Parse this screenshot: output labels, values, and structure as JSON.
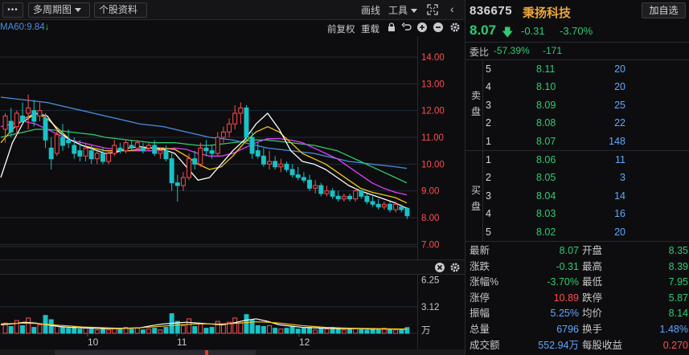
{
  "toolbar": {
    "more": "•••",
    "period": "多周期图",
    "stock_info": "个股资料",
    "draw": "画线",
    "tools": "工具",
    "fullscreen_icon": "expand-icon",
    "collapse_icon": "chevron-left-icon"
  },
  "ma_bar": {
    "ma60_text": "MA60:9.84",
    "ma60_color": "#4a90e2",
    "restore": "前复权",
    "reset": "重载"
  },
  "chart_data": [
    {
      "type": "candlestick",
      "price_axis_ticks": [
        "14.00",
        "13.00",
        "12.00",
        "11.00",
        "10.00",
        "9.00",
        "8.00",
        "7.00"
      ],
      "ylim": [
        6.8,
        14.6
      ],
      "candles": [
        {
          "o": 11.3,
          "h": 11.9,
          "l": 10.8,
          "c": 11.8
        },
        {
          "o": 11.6,
          "h": 12.1,
          "l": 11.0,
          "c": 11.2
        },
        {
          "o": 11.4,
          "h": 12.0,
          "l": 11.1,
          "c": 11.9
        },
        {
          "o": 11.8,
          "h": 12.3,
          "l": 11.5,
          "c": 11.6
        },
        {
          "o": 11.9,
          "h": 12.6,
          "l": 11.3,
          "c": 12.1
        },
        {
          "o": 12.0,
          "h": 12.4,
          "l": 11.4,
          "c": 11.6
        },
        {
          "o": 11.8,
          "h": 12.3,
          "l": 11.6,
          "c": 12.0
        },
        {
          "o": 11.7,
          "h": 11.9,
          "l": 10.6,
          "c": 10.9
        },
        {
          "o": 10.6,
          "h": 11.0,
          "l": 9.8,
          "c": 10.2
        },
        {
          "o": 10.4,
          "h": 11.3,
          "l": 10.3,
          "c": 11.1
        },
        {
          "o": 11.0,
          "h": 11.5,
          "l": 10.5,
          "c": 10.7
        },
        {
          "o": 10.9,
          "h": 11.3,
          "l": 10.6,
          "c": 10.8
        },
        {
          "o": 10.7,
          "h": 11.0,
          "l": 10.2,
          "c": 10.4
        },
        {
          "o": 10.5,
          "h": 10.9,
          "l": 10.1,
          "c": 10.3
        },
        {
          "o": 10.3,
          "h": 10.8,
          "l": 10.1,
          "c": 10.6
        },
        {
          "o": 10.5,
          "h": 10.7,
          "l": 10.0,
          "c": 10.2
        },
        {
          "o": 10.2,
          "h": 10.5,
          "l": 10.0,
          "c": 10.4
        },
        {
          "o": 10.4,
          "h": 10.6,
          "l": 10.0,
          "c": 10.1
        },
        {
          "o": 10.1,
          "h": 10.5,
          "l": 10.0,
          "c": 10.4
        },
        {
          "o": 10.4,
          "h": 10.9,
          "l": 10.3,
          "c": 10.7
        },
        {
          "o": 10.6,
          "h": 10.8,
          "l": 10.4,
          "c": 10.5
        },
        {
          "o": 10.5,
          "h": 10.9,
          "l": 10.4,
          "c": 10.8
        },
        {
          "o": 10.7,
          "h": 10.9,
          "l": 10.5,
          "c": 10.6
        },
        {
          "o": 10.6,
          "h": 10.9,
          "l": 10.5,
          "c": 10.8
        },
        {
          "o": 10.6,
          "h": 10.8,
          "l": 10.4,
          "c": 10.5
        },
        {
          "o": 10.6,
          "h": 10.8,
          "l": 10.5,
          "c": 10.7
        },
        {
          "o": 10.7,
          "h": 10.9,
          "l": 10.3,
          "c": 10.4
        },
        {
          "o": 10.4,
          "h": 10.6,
          "l": 10.2,
          "c": 10.5
        },
        {
          "o": 10.5,
          "h": 10.7,
          "l": 10.1,
          "c": 10.2
        },
        {
          "o": 10.2,
          "h": 10.4,
          "l": 9.0,
          "c": 9.3
        },
        {
          "o": 9.3,
          "h": 9.6,
          "l": 8.6,
          "c": 9.2
        },
        {
          "o": 9.2,
          "h": 9.7,
          "l": 9.0,
          "c": 9.5
        },
        {
          "o": 9.5,
          "h": 10.4,
          "l": 9.4,
          "c": 10.2
        },
        {
          "o": 10.2,
          "h": 10.5,
          "l": 9.8,
          "c": 10.0
        },
        {
          "o": 10.0,
          "h": 10.8,
          "l": 9.9,
          "c": 10.6
        },
        {
          "o": 10.6,
          "h": 10.9,
          "l": 10.3,
          "c": 10.5
        },
        {
          "o": 10.5,
          "h": 10.7,
          "l": 10.2,
          "c": 10.4
        },
        {
          "o": 10.4,
          "h": 11.2,
          "l": 10.3,
          "c": 11.0
        },
        {
          "o": 11.0,
          "h": 11.4,
          "l": 10.8,
          "c": 11.2
        },
        {
          "o": 11.2,
          "h": 11.7,
          "l": 11.0,
          "c": 11.5
        },
        {
          "o": 11.5,
          "h": 12.2,
          "l": 11.3,
          "c": 11.9
        },
        {
          "o": 11.9,
          "h": 12.3,
          "l": 11.5,
          "c": 12.1
        },
        {
          "o": 12.1,
          "h": 12.2,
          "l": 10.9,
          "c": 11.0
        },
        {
          "o": 11.0,
          "h": 11.2,
          "l": 10.2,
          "c": 10.4
        },
        {
          "o": 10.5,
          "h": 10.8,
          "l": 10.2,
          "c": 10.3
        },
        {
          "o": 10.3,
          "h": 10.6,
          "l": 9.9,
          "c": 10.0
        },
        {
          "o": 10.0,
          "h": 10.5,
          "l": 9.8,
          "c": 10.1
        },
        {
          "o": 10.1,
          "h": 10.3,
          "l": 9.8,
          "c": 9.9
        },
        {
          "o": 9.9,
          "h": 10.2,
          "l": 9.7,
          "c": 10.0
        },
        {
          "o": 10.0,
          "h": 10.1,
          "l": 9.7,
          "c": 9.8
        },
        {
          "o": 9.8,
          "h": 10.0,
          "l": 9.5,
          "c": 9.6
        },
        {
          "o": 9.6,
          "h": 9.9,
          "l": 9.4,
          "c": 9.5
        },
        {
          "o": 9.5,
          "h": 9.7,
          "l": 9.3,
          "c": 9.4
        },
        {
          "o": 9.4,
          "h": 9.6,
          "l": 9.0,
          "c": 9.1
        },
        {
          "o": 9.1,
          "h": 9.4,
          "l": 8.9,
          "c": 9.2
        },
        {
          "o": 9.2,
          "h": 9.3,
          "l": 8.8,
          "c": 8.9
        },
        {
          "o": 8.9,
          "h": 9.2,
          "l": 8.8,
          "c": 9.0
        },
        {
          "o": 9.0,
          "h": 9.1,
          "l": 8.7,
          "c": 8.8
        },
        {
          "o": 8.8,
          "h": 9.0,
          "l": 8.6,
          "c": 8.7
        },
        {
          "o": 8.7,
          "h": 8.9,
          "l": 8.6,
          "c": 8.8
        },
        {
          "o": 8.8,
          "h": 8.9,
          "l": 8.6,
          "c": 8.7
        },
        {
          "o": 8.7,
          "h": 9.1,
          "l": 8.6,
          "c": 9.0
        },
        {
          "o": 9.0,
          "h": 9.1,
          "l": 8.7,
          "c": 8.8
        },
        {
          "o": 8.8,
          "h": 8.9,
          "l": 8.5,
          "c": 8.6
        },
        {
          "o": 8.6,
          "h": 8.8,
          "l": 8.4,
          "c": 8.5
        },
        {
          "o": 8.5,
          "h": 8.7,
          "l": 8.3,
          "c": 8.4
        },
        {
          "o": 8.4,
          "h": 8.6,
          "l": 8.3,
          "c": 8.5
        },
        {
          "o": 8.5,
          "h": 8.6,
          "l": 8.2,
          "c": 8.3
        },
        {
          "o": 8.3,
          "h": 8.6,
          "l": 8.2,
          "c": 8.5
        },
        {
          "o": 8.4,
          "h": 8.5,
          "l": 8.2,
          "c": 8.3
        },
        {
          "o": 8.35,
          "h": 8.39,
          "l": 7.95,
          "c": 8.07
        }
      ],
      "moving_averages": [
        {
          "name": "MA60",
          "color": "#4a90e2",
          "values": [
            12.5,
            12.45,
            12.4,
            12.35,
            12.3,
            12.2,
            12.1,
            12.0,
            11.9,
            11.8,
            11.7,
            11.6,
            11.5,
            11.45,
            11.4,
            11.3,
            11.2,
            11.1,
            11.0,
            10.95,
            10.9,
            10.8,
            10.7,
            10.6,
            10.55,
            10.5,
            10.45,
            10.4,
            10.3,
            10.2,
            10.1,
            10.05,
            10.0,
            9.95,
            9.9,
            9.84
          ]
        },
        {
          "name": "MA30",
          "color": "#2ecc71",
          "values": [
            11.0,
            11.1,
            11.2,
            11.3,
            11.3,
            11.25,
            11.2,
            11.15,
            11.1,
            11.0,
            10.95,
            10.9,
            10.85,
            10.8,
            10.8,
            10.8,
            10.75,
            10.7,
            10.7,
            10.75,
            10.8,
            10.85,
            10.9,
            10.9,
            10.85,
            10.8,
            10.75,
            10.7,
            10.6,
            10.5,
            10.3,
            10.1,
            9.9,
            9.7,
            9.5,
            9.3
          ]
        },
        {
          "name": "MA20",
          "color": "#e040fb",
          "values": [
            11.4,
            11.5,
            11.6,
            11.5,
            11.3,
            11.1,
            10.9,
            10.8,
            10.7,
            10.6,
            10.55,
            10.5,
            10.5,
            10.5,
            10.55,
            10.6,
            10.55,
            10.4,
            10.3,
            10.3,
            10.4,
            10.6,
            10.8,
            10.95,
            10.95,
            10.9,
            10.8,
            10.6,
            10.4,
            10.2,
            9.9,
            9.6,
            9.3,
            9.1,
            8.95,
            8.85
          ]
        },
        {
          "name": "MA10",
          "color": "#f5c518",
          "values": [
            10.8,
            11.3,
            11.7,
            11.9,
            11.7,
            11.3,
            10.9,
            10.7,
            10.6,
            10.5,
            10.5,
            10.5,
            10.55,
            10.6,
            10.6,
            10.55,
            10.3,
            10.0,
            9.8,
            9.9,
            10.3,
            10.8,
            11.2,
            11.4,
            11.2,
            10.8,
            10.4,
            10.2,
            10.0,
            9.7,
            9.4,
            9.1,
            8.95,
            8.85,
            8.75,
            8.55
          ]
        },
        {
          "name": "MA5",
          "color": "#ffffff",
          "values": [
            9.5,
            10.8,
            11.6,
            11.9,
            11.8,
            11.2,
            10.9,
            10.7,
            10.55,
            10.4,
            10.45,
            10.6,
            10.65,
            10.6,
            10.55,
            10.4,
            9.9,
            9.4,
            9.5,
            10.0,
            10.5,
            10.9,
            11.5,
            11.9,
            11.3,
            10.5,
            10.1,
            10.0,
            9.8,
            9.5,
            9.2,
            9.0,
            8.85,
            8.7,
            8.55,
            8.35
          ]
        }
      ]
    },
    {
      "type": "bar",
      "title": "volume",
      "volume_axis_ticks": [
        "6.25",
        "3.12",
        "万"
      ],
      "ylim": [
        0,
        6.5
      ],
      "volumes": [
        1.2,
        0.8,
        1.5,
        0.9,
        1.8,
        0.7,
        1.0,
        2.1,
        1.6,
        0.9,
        0.7,
        0.6,
        0.8,
        0.5,
        0.6,
        0.5,
        0.4,
        0.5,
        0.4,
        0.6,
        0.5,
        0.7,
        0.5,
        0.6,
        0.4,
        0.5,
        0.6,
        0.4,
        0.7,
        2.3,
        1.4,
        0.9,
        1.7,
        0.8,
        1.1,
        0.6,
        0.7,
        1.4,
        1.0,
        1.3,
        1.8,
        1.2,
        2.2,
        1.6,
        0.9,
        0.8,
        0.9,
        0.6,
        0.5,
        0.6,
        0.8,
        0.5,
        0.6,
        0.7,
        0.4,
        0.6,
        0.5,
        0.7,
        0.5,
        0.4,
        0.5,
        0.6,
        0.5,
        0.4,
        0.5,
        0.4,
        0.6,
        0.5,
        0.4,
        0.5,
        0.68
      ],
      "vol_ma": [
        {
          "name": "VMA5",
          "color": "#ffffff",
          "values": [
            1.0,
            1.1,
            1.3,
            1.2,
            1.0,
            0.8,
            0.7,
            0.65,
            0.6,
            0.55,
            0.55,
            0.6,
            0.65,
            0.9,
            1.1,
            1.2,
            1.3,
            1.2,
            1.1,
            1.0,
            1.2,
            1.5,
            1.7,
            1.4,
            1.0,
            0.85,
            0.7,
            0.65,
            0.6,
            0.55,
            0.55,
            0.55,
            0.5,
            0.5,
            0.5,
            0.5
          ]
        },
        {
          "name": "VMA10",
          "color": "#f5c518",
          "values": [
            1.1,
            1.15,
            1.2,
            1.15,
            1.05,
            0.95,
            0.85,
            0.75,
            0.7,
            0.65,
            0.6,
            0.6,
            0.65,
            0.75,
            0.85,
            0.95,
            1.05,
            1.1,
            1.1,
            1.1,
            1.15,
            1.25,
            1.35,
            1.3,
            1.2,
            1.05,
            0.9,
            0.8,
            0.7,
            0.65,
            0.6,
            0.58,
            0.55,
            0.53,
            0.52,
            0.5
          ]
        }
      ],
      "x_tick_labels": [
        "10",
        "11",
        "12"
      ]
    }
  ],
  "quote": {
    "code": "836675",
    "name": "秉扬科技",
    "add_watch": "加自选",
    "price": "8.07",
    "change": "-0.31",
    "change_pct": "-3.70%",
    "weibi_label": "委比",
    "weibi_ratio": "-57.39%",
    "weibi_diff": "-171",
    "sell_label": "卖盘",
    "buy_label": "买盘",
    "asks": [
      {
        "level": "5",
        "price": "8.11",
        "vol": "20"
      },
      {
        "level": "4",
        "price": "8.10",
        "vol": "20"
      },
      {
        "level": "3",
        "price": "8.09",
        "vol": "25"
      },
      {
        "level": "2",
        "price": "8.08",
        "vol": "22"
      },
      {
        "level": "1",
        "price": "8.07",
        "vol": "148"
      }
    ],
    "bids": [
      {
        "level": "1",
        "price": "8.06",
        "vol": "11"
      },
      {
        "level": "2",
        "price": "8.05",
        "vol": "3"
      },
      {
        "level": "3",
        "price": "8.04",
        "vol": "14"
      },
      {
        "level": "4",
        "price": "8.03",
        "vol": "16"
      },
      {
        "level": "5",
        "price": "8.02",
        "vol": "20"
      }
    ],
    "stats": [
      {
        "l_label": "最新",
        "l_val": "8.07",
        "l_color": "green",
        "r_label": "开盘",
        "r_val": "8.35",
        "r_color": "green"
      },
      {
        "l_label": "涨跌",
        "l_val": "-0.31",
        "l_color": "green",
        "r_label": "最高",
        "r_val": "8.39",
        "r_color": "green"
      },
      {
        "l_label": "涨幅%",
        "l_val": "-3.70%",
        "l_color": "green",
        "r_label": "最低",
        "r_val": "7.95",
        "r_color": "green"
      },
      {
        "l_label": "涨停",
        "l_val": "10.89",
        "l_color": "red",
        "r_label": "跌停",
        "r_val": "5.87",
        "r_color": "green"
      },
      {
        "l_label": "振幅",
        "l_val": "5.25%",
        "l_color": "blue",
        "r_label": "均价",
        "r_val": "8.14",
        "r_color": "green"
      },
      {
        "l_label": "总量",
        "l_val": "6796",
        "l_color": "blue",
        "r_label": "换手",
        "r_val": "1.48%",
        "r_color": "blue"
      },
      {
        "l_label": "成交额",
        "l_val": "552.94万",
        "l_color": "blue",
        "r_label": "每股收益",
        "r_val": "0.270",
        "r_color": "red"
      }
    ]
  },
  "colors": {
    "up": "#ff4d4f",
    "down_candle": "#19c2c7",
    "down_text": "#2ecc71",
    "grid": "#1e2a36"
  }
}
